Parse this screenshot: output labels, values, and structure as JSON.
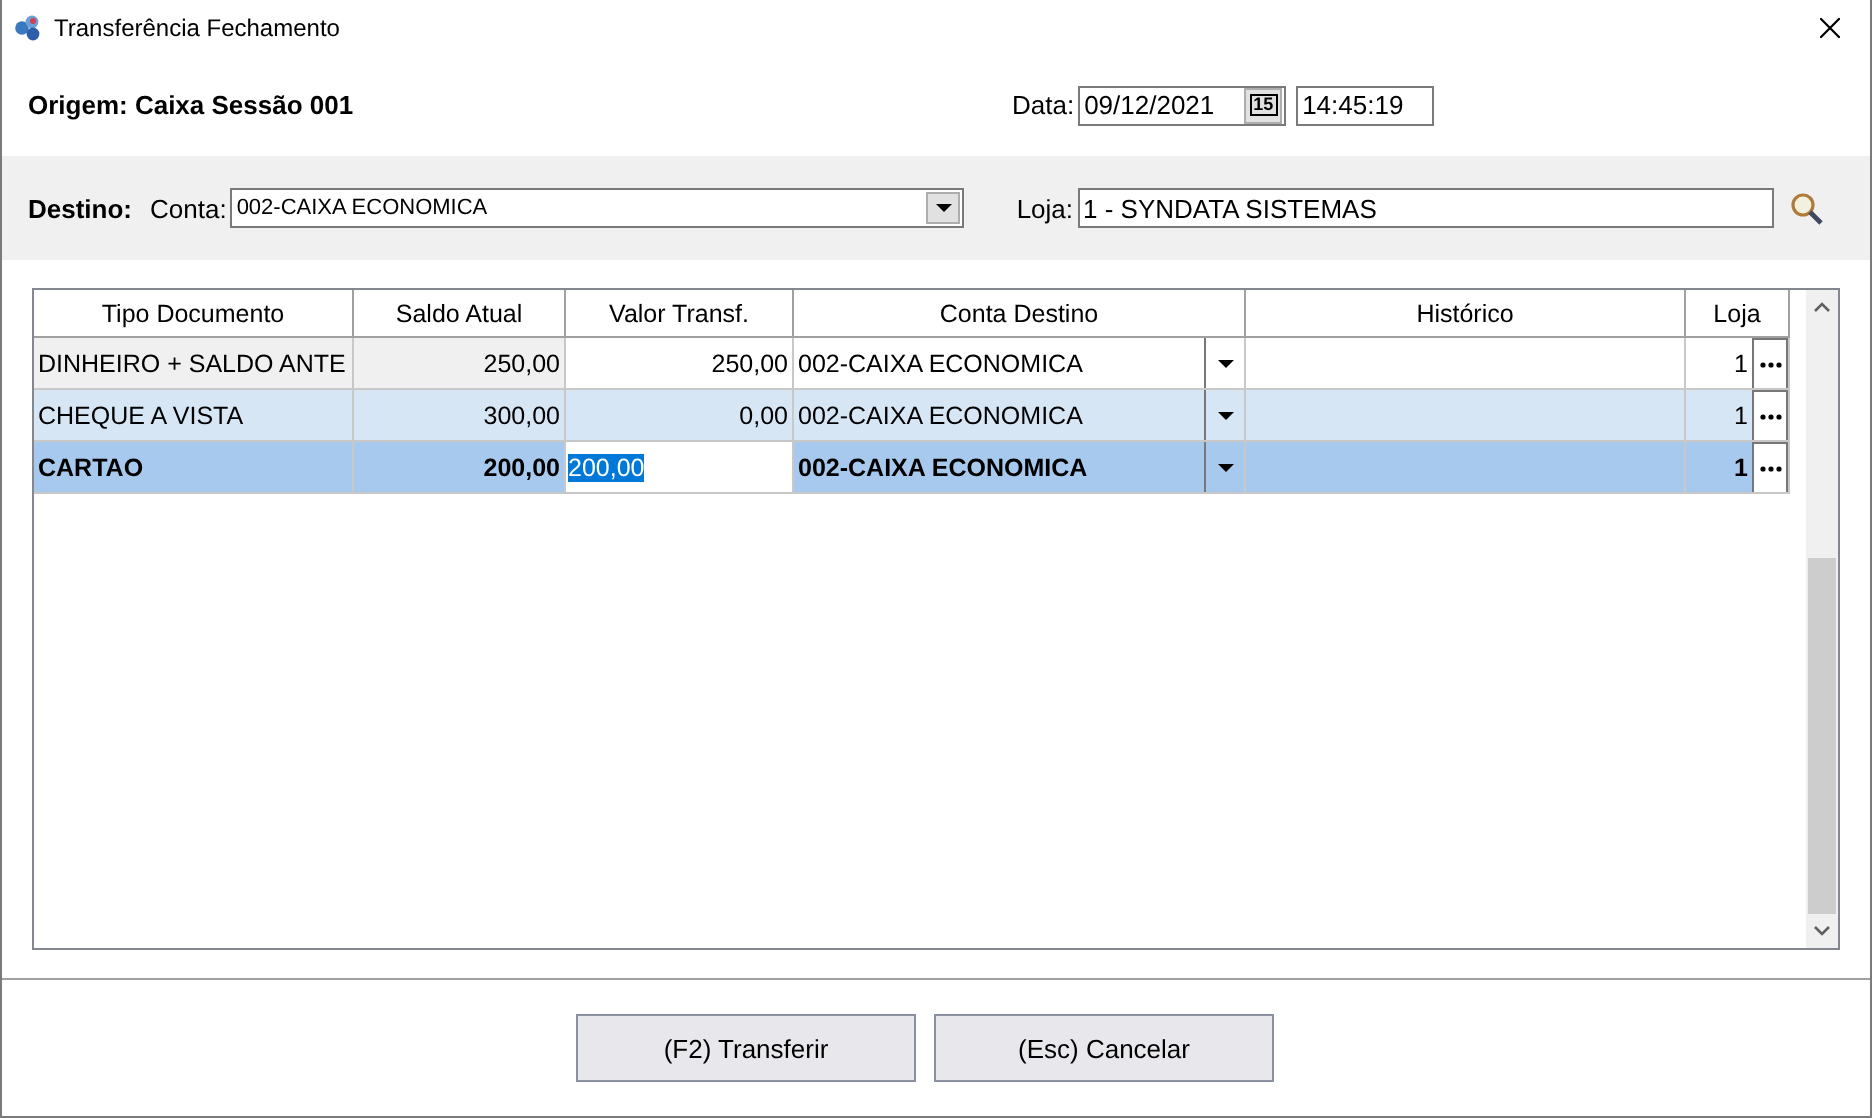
{
  "window": {
    "title": "Transferência Fechamento"
  },
  "origin": {
    "label": "Origem: Caixa Sessão 001"
  },
  "date": {
    "label": "Data:",
    "value": "09/12/2021",
    "calendar_label": "15",
    "time": "14:45:19"
  },
  "destination": {
    "label": "Destino:",
    "account_label": "Conta:",
    "account_value": "002-CAIXA ECONOMICA",
    "store_label": "Loja:",
    "store_value": "1 - SYNDATA SISTEMAS"
  },
  "table": {
    "columns": [
      {
        "label": "Tipo Documento",
        "readonly": true
      },
      {
        "label": "Saldo Atual",
        "readonly": true
      },
      {
        "label": "Valor Transf.",
        "readonly": false
      },
      {
        "label": "Conta Destino",
        "readonly": false
      },
      {
        "label": "Histórico",
        "readonly": false
      },
      {
        "label": "Loja",
        "readonly": false
      }
    ],
    "rows": [
      {
        "selected": false,
        "editing": false,
        "cells": [
          "DINHEIRO + SALDO ANTE",
          "250,00",
          "250,00",
          "002-CAIXA ECONOMICA",
          "",
          "1"
        ]
      },
      {
        "selected": false,
        "editing": false,
        "cells": [
          "CHEQUE A VISTA",
          "300,00",
          "0,00",
          "002-CAIXA ECONOMICA",
          "",
          "1"
        ]
      },
      {
        "selected": true,
        "editing": true,
        "cells": [
          "CARTAO",
          "200,00",
          "200,00",
          "002-CAIXA ECONOMICA",
          "",
          "1"
        ]
      }
    ]
  },
  "buttons": [
    "(F2) Transferir",
    "(Esc) Cancelar"
  ]
}
